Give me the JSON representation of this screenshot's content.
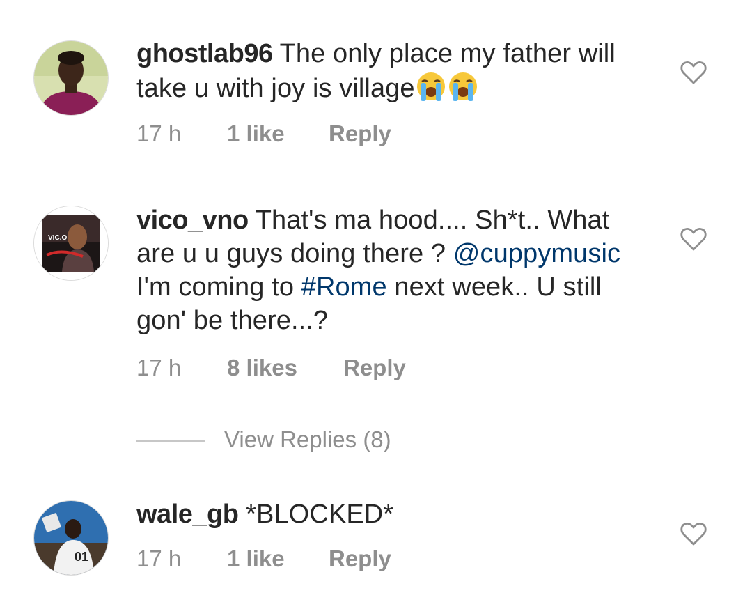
{
  "comments": [
    {
      "username": "ghostlab96",
      "text": " The only place my father will take u with joy is village",
      "emoji": [
        "loudly-crying-face",
        "loudly-crying-face"
      ],
      "time": "17 h",
      "likes": "1 like",
      "reply": "Reply"
    },
    {
      "username": "vico_vno",
      "text_1": " That's ma hood.... Sh*t.. What are u u guys doing there ? ",
      "mention": "@cuppymusic",
      "text_2": " I'm coming to ",
      "hashtag": "#Rome",
      "text_3": " next week.. U still gon' be there...?",
      "avatar_text": "VIC.O",
      "time": "17 h",
      "likes": "8 likes",
      "reply": "Reply",
      "view_replies": "View Replies (8)"
    },
    {
      "username": "wale_gb",
      "text": " *BLOCKED*",
      "avatar_text": "01",
      "time": "17 h",
      "likes": "1 like",
      "reply": "Reply"
    }
  ],
  "icons": {
    "like": "heart-outline-icon",
    "emoji": "loudly-crying-face"
  },
  "colors": {
    "text": "#262626",
    "secondary": "#8e8e8e",
    "link": "#00376b"
  }
}
